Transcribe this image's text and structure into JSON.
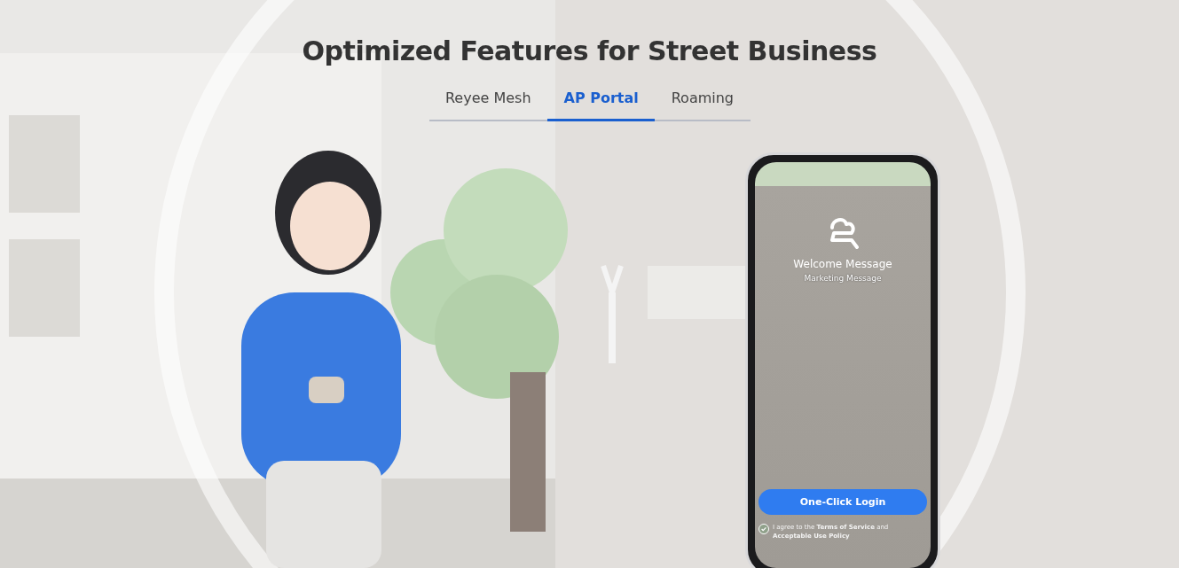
{
  "title": "Optimized Features for Street Business",
  "tabs": [
    {
      "label": "Reyee Mesh",
      "selected": false
    },
    {
      "label": "AP Portal",
      "selected": true
    },
    {
      "label": "Roaming",
      "selected": false
    }
  ],
  "phone": {
    "welcome": "Welcome Message",
    "marketing": "Marketing Message",
    "login_button": "One-Click Login",
    "agree": {
      "checked": true,
      "text": "I agree to the **Terms of Service** and **Acceptable Use Policy**"
    }
  }
}
